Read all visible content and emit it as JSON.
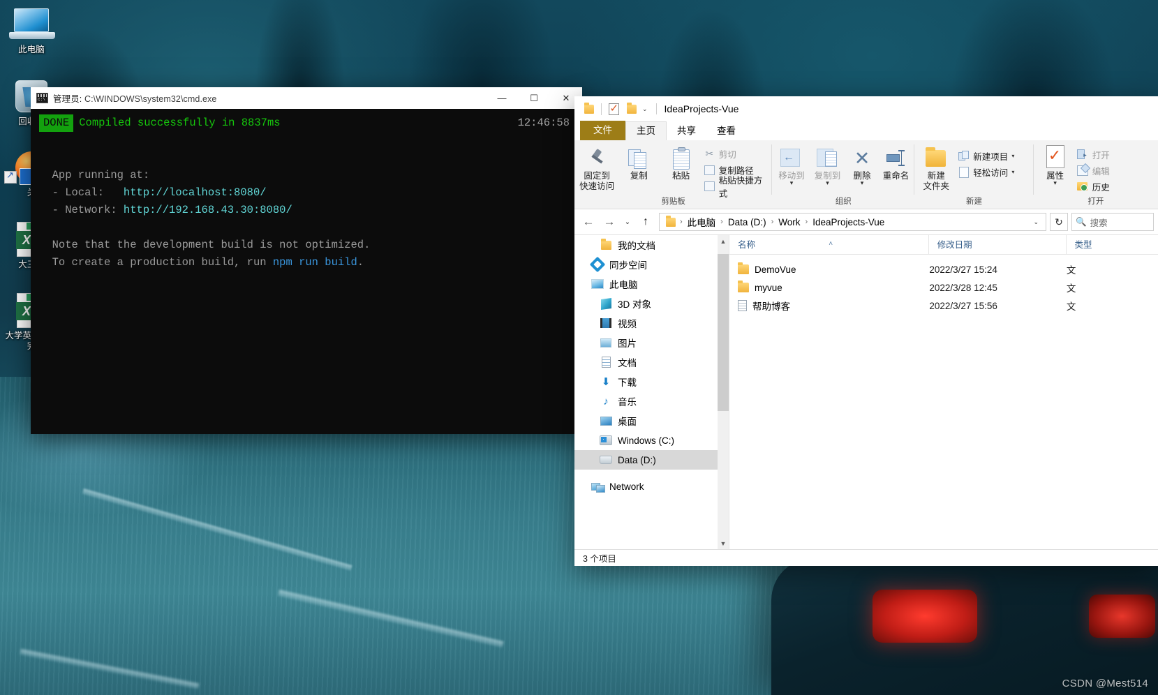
{
  "desktop": {
    "icons": [
      {
        "name": "此电脑",
        "icon": "this-pc-icon"
      },
      {
        "name": "回收站",
        "icon": "recycle-bin-icon"
      },
      {
        "name": "关",
        "icon": "browser-shortcut-icon"
      },
      {
        "name": "大三下",
        "icon": "excel-file-icon"
      },
      {
        "name": "大学英语词汇完",
        "icon": "excel-file-icon"
      }
    ],
    "watermark": "CSDN @Mest514"
  },
  "cmd": {
    "title_prefix": "管理员:",
    "title_path": "C:\\WINDOWS\\system32\\cmd.exe",
    "icon": "cmd-icon",
    "buttons": {
      "minimize": "—",
      "maximize": "☐",
      "close": "✕"
    },
    "clock": "12:46:58",
    "badge": "DONE",
    "compiled_line": "Compiled successfully in 8837ms",
    "app_running_at": "  App running at:",
    "local_label": "  - Local:   ",
    "local_url": "http://localhost:8080/",
    "network_label": "  - Network: ",
    "network_url": "http://192.168.43.30:8080/",
    "note_line": "  Note that the development build is not optimized.",
    "create_line_a": "  To create a production build, run ",
    "create_cmd": "npm run build",
    "create_line_b": "."
  },
  "explorer": {
    "title": "IdeaProjects-Vue",
    "quick_access": [
      {
        "name": "properties-quick-icon",
        "glyph": "folder"
      },
      {
        "name": "new-folder-quick-icon",
        "glyph": "check"
      },
      {
        "name": "folder-quick-icon",
        "glyph": "folder"
      }
    ],
    "tabs": [
      {
        "label": "文件",
        "name": "tab-file",
        "state": "file"
      },
      {
        "label": "主页",
        "name": "tab-home",
        "state": "active"
      },
      {
        "label": "共享",
        "name": "tab-share",
        "state": "normal"
      },
      {
        "label": "查看",
        "name": "tab-view",
        "state": "normal"
      }
    ],
    "ribbon": {
      "groups": [
        {
          "label": "剪贴板"
        },
        {
          "label": "组织"
        },
        {
          "label": "新建"
        },
        {
          "label": "打开"
        }
      ],
      "pin_to_quick_access": "固定到\n快速访问",
      "pin_line1": "固定到",
      "pin_line2": "快速访问",
      "copy": "复制",
      "paste": "粘贴",
      "cut": "剪切",
      "copy_path": "复制路径",
      "paste_shortcut": "粘贴快捷方式",
      "move_to": "移动到",
      "copy_to": "复制到",
      "delete": "删除",
      "rename": "重命名",
      "new_folder_l1": "新建",
      "new_folder_l2": "文件夹",
      "new_item": "新建项目",
      "easy_access": "轻松访问",
      "properties": "属性",
      "open": "打开",
      "edit": "编辑",
      "history": "历史"
    },
    "address": {
      "back": "←",
      "forward": "→",
      "recent": "⌄",
      "up": "↑",
      "crumbs": [
        "此电脑",
        "Data (D:)",
        "Work",
        "IdeaProjects-Vue"
      ],
      "separator": "›",
      "dropdown_caret": "⌄",
      "refresh": "↻",
      "search_placeholder": "搜索"
    },
    "nav_items": [
      {
        "label": "我的文档",
        "icon": "folder-icon",
        "indent": true,
        "selected": false
      },
      {
        "label": "同步空间",
        "icon": "sync-icon",
        "indent": false,
        "selected": false
      },
      {
        "label": "此电脑",
        "icon": "this-pc-icon",
        "indent": false,
        "selected": false
      },
      {
        "label": "3D 对象",
        "icon": "3d-objects-icon",
        "indent": true,
        "selected": false
      },
      {
        "label": "视频",
        "icon": "videos-icon",
        "indent": true,
        "selected": false
      },
      {
        "label": "图片",
        "icon": "pictures-icon",
        "indent": true,
        "selected": false
      },
      {
        "label": "文档",
        "icon": "documents-icon",
        "indent": true,
        "selected": false
      },
      {
        "label": "下载",
        "icon": "downloads-icon",
        "indent": true,
        "selected": false
      },
      {
        "label": "音乐",
        "icon": "music-icon",
        "indent": true,
        "selected": false
      },
      {
        "label": "桌面",
        "icon": "desktop-icon",
        "indent": true,
        "selected": false
      },
      {
        "label": "Windows (C:)",
        "icon": "drive-c-icon",
        "indent": true,
        "selected": false
      },
      {
        "label": "Data (D:)",
        "icon": "drive-d-icon",
        "indent": true,
        "selected": true
      },
      {
        "label": "Network",
        "icon": "network-icon",
        "indent": false,
        "selected": false
      }
    ],
    "columns": [
      {
        "label": "名称",
        "sorted": true
      },
      {
        "label": "修改日期",
        "sorted": false
      },
      {
        "label": "类型",
        "sorted": false
      }
    ],
    "files": [
      {
        "name": "DemoVue",
        "date": "2022/3/27 15:24",
        "type": "文",
        "icon": "folder-icon"
      },
      {
        "name": "myvue",
        "date": "2022/3/28 12:45",
        "type": "文",
        "icon": "folder-icon"
      },
      {
        "name": "帮助博客",
        "date": "2022/3/27 15:56",
        "type": "文",
        "icon": "document-icon"
      }
    ],
    "status": "3 个项目"
  }
}
